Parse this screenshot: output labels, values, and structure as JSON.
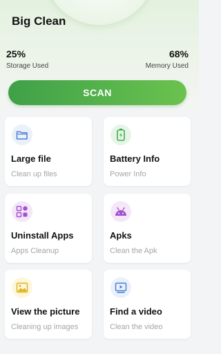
{
  "app": {
    "title": "Big Clean"
  },
  "stats": {
    "storage": {
      "value": "25%",
      "label": "Storage Used"
    },
    "memory": {
      "value": "68%",
      "label": "Memory Used"
    }
  },
  "scan_label": "SCAN",
  "cards": [
    {
      "title": "Large file",
      "subtitle": "Clean up files",
      "icon": "folder-icon",
      "color": "#4a7fd8"
    },
    {
      "title": "Battery Info",
      "subtitle": "Power Info",
      "icon": "battery-icon",
      "color": "#3fae47"
    },
    {
      "title": "Uninstall Apps",
      "subtitle": "Apps Cleanup",
      "icon": "apps-grid-icon",
      "color": "#a64fd1"
    },
    {
      "title": "Apks",
      "subtitle": "Clean the Apk",
      "icon": "android-icon",
      "color": "#a64fd1"
    },
    {
      "title": "View the picture",
      "subtitle": "Cleaning up images",
      "icon": "image-icon",
      "color": "#e0b321"
    },
    {
      "title": "Find a video",
      "subtitle": "Clean the video",
      "icon": "video-icon",
      "color": "#4a7fd8"
    }
  ]
}
